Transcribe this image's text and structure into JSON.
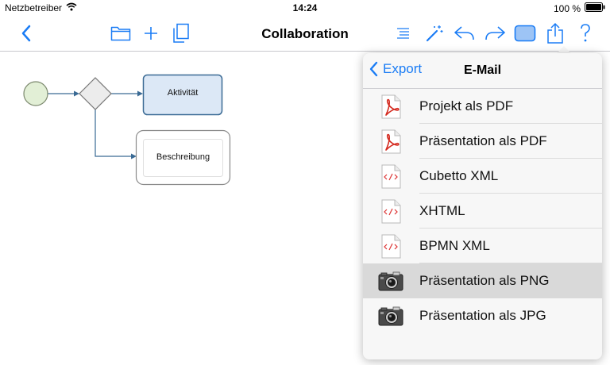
{
  "status_bar": {
    "carrier": "Netzbetreiber",
    "time": "14:24",
    "battery": "100 %"
  },
  "nav_bar": {
    "title": "Collaboration"
  },
  "diagram": {
    "nodes": {
      "activity": "Aktivität",
      "description": "Beschreibung"
    }
  },
  "popover": {
    "back_label": "Export",
    "title": "E-Mail",
    "items": [
      {
        "label": "Projekt als PDF",
        "icon": "pdf-icon"
      },
      {
        "label": "Präsentation als PDF",
        "icon": "pdf-icon"
      },
      {
        "label": "Cubetto XML",
        "icon": "code-file-icon"
      },
      {
        "label": "XHTML",
        "icon": "code-file-icon"
      },
      {
        "label": "BPMN XML",
        "icon": "code-file-icon"
      },
      {
        "label": "Präsentation als PNG",
        "icon": "camera-icon",
        "selected": true
      },
      {
        "label": "Präsentation als JPG",
        "icon": "camera-icon"
      }
    ]
  },
  "colors": {
    "accent": "#1a7cf5",
    "start_event_fill": "#e2efd6",
    "activity_fill": "#dce8f6",
    "connector": "#3a6a94"
  }
}
